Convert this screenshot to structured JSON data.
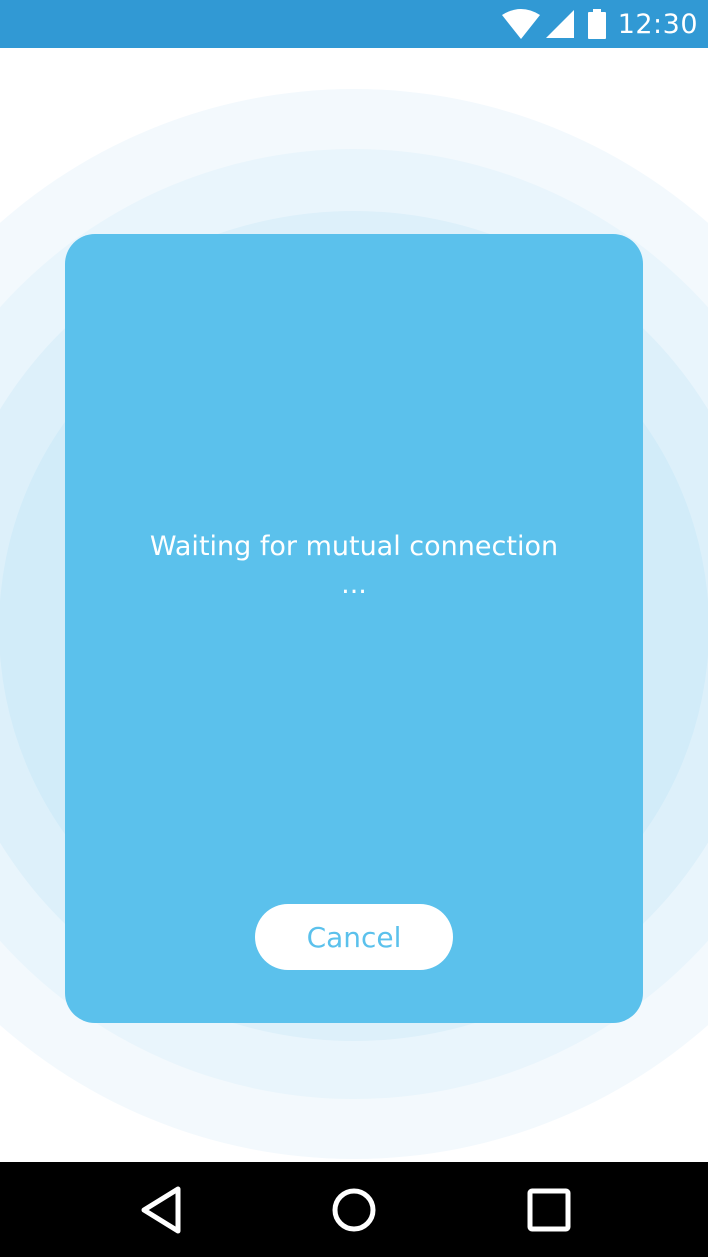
{
  "status_bar": {
    "time": "12:30",
    "icons": [
      "wifi-icon",
      "cell-signal-icon",
      "battery-icon"
    ],
    "background": "#3199d4"
  },
  "dialog": {
    "message": "Waiting for mutual connection\n...",
    "cancel_label": "Cancel",
    "background": "#5bc1ec"
  },
  "nav_bar": {
    "buttons": [
      "back-icon",
      "home-icon",
      "recents-icon"
    ]
  }
}
